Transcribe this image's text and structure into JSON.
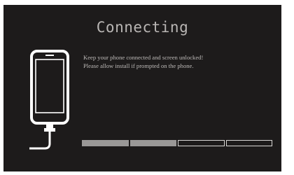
{
  "title": "Connecting",
  "message": {
    "line1": "Keep your phone connected and screen unlocked!",
    "line2": "Please allow install if prompted on the phone."
  },
  "icons": {
    "device": "phone-with-cable-icon"
  },
  "progress": {
    "segments": 4,
    "completed": 2
  },
  "colors": {
    "background": "#1d1b1b",
    "text": "#bdbab8",
    "progress_filled": "#9a9897",
    "progress_empty_border": "#d8d6d4"
  }
}
